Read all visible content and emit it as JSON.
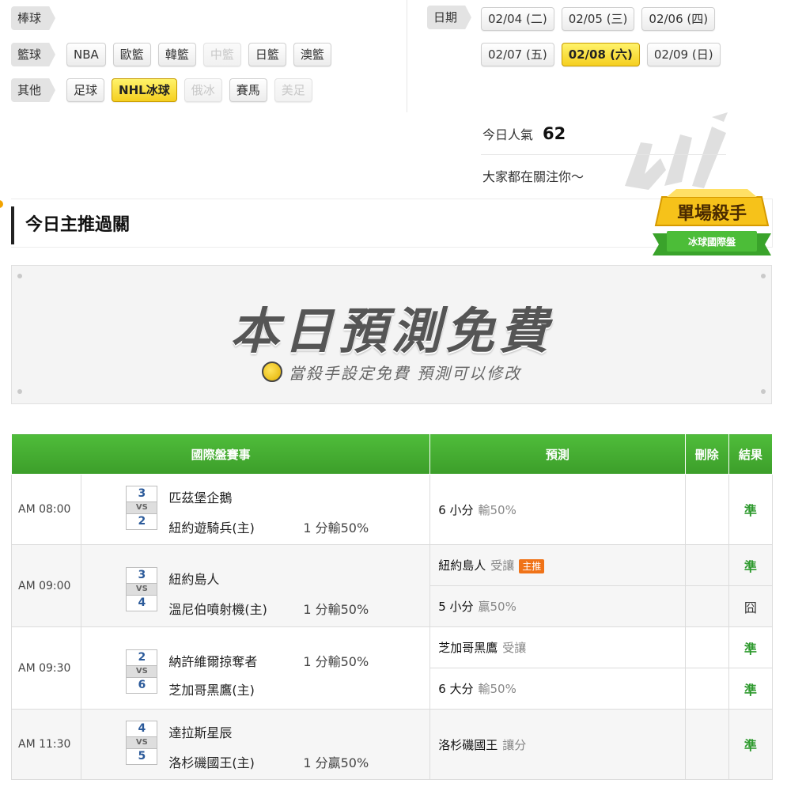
{
  "categories": [
    {
      "label": "棒球",
      "items": []
    },
    {
      "label": "籃球",
      "items": [
        {
          "label": "NBA",
          "state": "normal"
        },
        {
          "label": "歐籃",
          "state": "normal"
        },
        {
          "label": "韓籃",
          "state": "normal"
        },
        {
          "label": "中籃",
          "state": "disabled"
        },
        {
          "label": "日籃",
          "state": "normal"
        },
        {
          "label": "澳籃",
          "state": "normal"
        }
      ]
    },
    {
      "label": "其他",
      "items": [
        {
          "label": "足球",
          "state": "normal"
        },
        {
          "label": "NHL冰球",
          "state": "active"
        },
        {
          "label": "俄冰",
          "state": "disabled"
        },
        {
          "label": "賽馬",
          "state": "normal"
        },
        {
          "label": "美足",
          "state": "disabled"
        }
      ]
    }
  ],
  "dates": {
    "label": "日期",
    "row1": [
      {
        "label": "02/04 (二)",
        "active": false
      },
      {
        "label": "02/05 (三)",
        "active": false
      },
      {
        "label": "02/06 (四)",
        "active": false
      }
    ],
    "row2": [
      {
        "label": "02/07 (五)",
        "active": false
      },
      {
        "label": "02/08 (六)",
        "active": true
      },
      {
        "label": "02/09 (日)",
        "active": false
      }
    ]
  },
  "popularity": {
    "label": "今日人氣",
    "value": "62",
    "follow_text": "大家都在關注你～"
  },
  "section": {
    "title": "今日主推過關",
    "badge_title": "單場殺手",
    "badge_sub": "冰球國際盤"
  },
  "banner": {
    "title": "本日預測免費",
    "subtitle": "當殺手設定免費 預測可以修改"
  },
  "colors": {
    "header_green": "#46ad33",
    "active_yellow": "#f5cf20",
    "ok_green": "#2e9a2e",
    "tag_orange": "#f07318"
  },
  "table": {
    "headers": {
      "event": "國際盤賽事",
      "prediction": "預測",
      "delete": "刪除",
      "result": "結果"
    },
    "vs": "VS",
    "games": [
      {
        "time": "AM 08:00",
        "away_score": "3",
        "away": "匹茲堡企鵝",
        "home_score": "2",
        "home": "紐約遊騎兵(主)",
        "spread": "1 分輸50%",
        "spread_row": "home",
        "preds": [
          {
            "main": "6 小分",
            "sub": "輸50%",
            "tag": "",
            "result": "準"
          }
        ]
      },
      {
        "time": "AM 09:00",
        "away_score": "3",
        "away": "紐約島人",
        "home_score": "4",
        "home": "溫尼伯噴射機(主)",
        "spread": "1 分輸50%",
        "spread_row": "home",
        "preds": [
          {
            "main": "紐約島人",
            "sub": "受讓",
            "tag": "主推",
            "result": "準"
          },
          {
            "main": "5 小分",
            "sub": "贏50%",
            "tag": "",
            "result": "囧"
          }
        ]
      },
      {
        "time": "AM 09:30",
        "away_score": "2",
        "away": "納許維爾掠奪者",
        "home_score": "6",
        "home": "芝加哥黑鷹(主)",
        "spread": "1 分輸50%",
        "spread_row": "away",
        "preds": [
          {
            "main": "芝加哥黑鷹",
            "sub": "受讓",
            "tag": "",
            "result": "準"
          },
          {
            "main": "6 大分",
            "sub": "輸50%",
            "tag": "",
            "result": "準"
          }
        ]
      },
      {
        "time": "AM 11:30",
        "away_score": "4",
        "away": "達拉斯星辰",
        "home_score": "5",
        "home": "洛杉磯國王(主)",
        "spread": "1 分贏50%",
        "spread_row": "home",
        "preds": [
          {
            "main": "洛杉磯國王",
            "sub": "讓分",
            "tag": "",
            "result": "準"
          }
        ]
      }
    ]
  }
}
